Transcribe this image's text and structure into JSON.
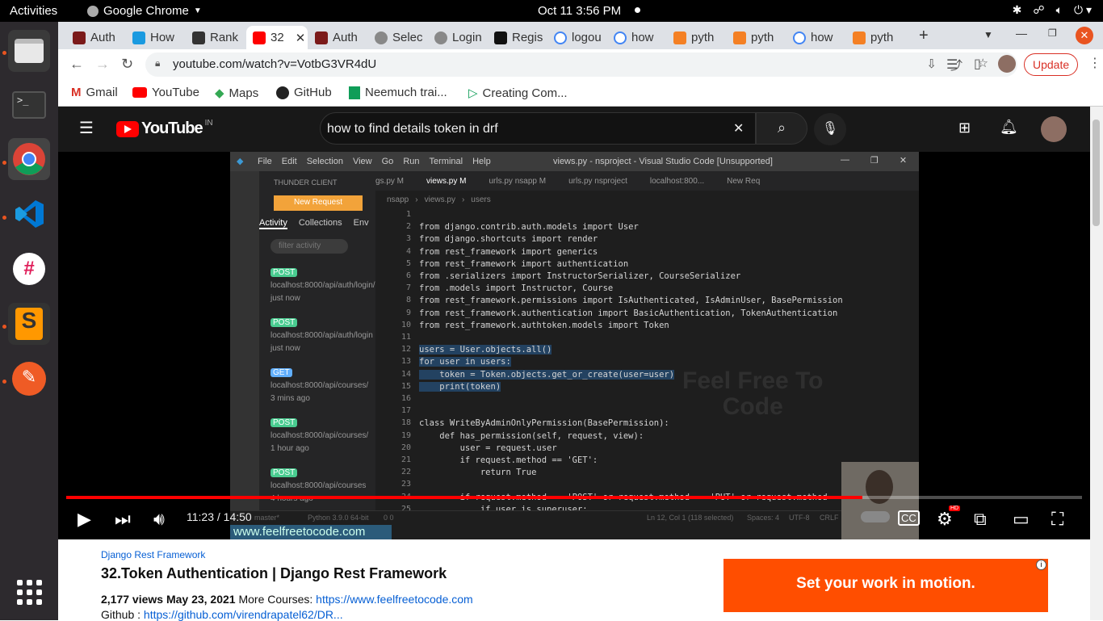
{
  "topbar": {
    "activities": "Activities",
    "app": "Google Chrome",
    "clock": "Oct 11  3:56 PM"
  },
  "dock": [
    "Files",
    "Terminal",
    "Google Chrome",
    "Visual Studio Code",
    "Slack",
    "Sublime Text",
    "Postman",
    "Show Applications"
  ],
  "tabs": [
    "Auth",
    "How",
    "Rank",
    "32",
    "Auth",
    "Selec",
    "Login",
    "Regis",
    "logou",
    "how",
    "pyth",
    "pyth",
    "how",
    "pyth"
  ],
  "omnibox": {
    "url": "youtube.com/watch?v=VotbG3VR4dU",
    "update": "Update"
  },
  "bookmarks": [
    "Gmail",
    "YouTube",
    "Maps",
    "GitHub",
    "Neemuch trai...",
    "Creating Com..."
  ],
  "youtube": {
    "logo": "YouTube",
    "region": "IN",
    "search_value": "how to find details token  in drf"
  },
  "vscode": {
    "title": "views.py - nsproject - Visual Studio Code [Unsupported]",
    "menu": [
      "File",
      "Edit",
      "Selection",
      "View",
      "Go",
      "Run",
      "Terminal",
      "Help"
    ],
    "panel_title": "THUNDER CLIENT",
    "new_request": "New Request",
    "panel_tabs": [
      "Activity",
      "Collections",
      "Env"
    ],
    "filter_placeholder": "filter activity",
    "activity": [
      {
        "method": "POST",
        "url": "localhost:8000/api/auth/login/",
        "time": "just now"
      },
      {
        "method": "POST",
        "url": "localhost:8000/api/auth/login",
        "time": "just now"
      },
      {
        "method": "GET",
        "url": "localhost:8000/api/courses/",
        "time": "3 mins ago"
      },
      {
        "method": "POST",
        "url": "localhost:8000/api/courses/",
        "time": "1 hour ago"
      },
      {
        "method": "POST",
        "url": "localhost:8000/api/courses",
        "time": "4 hours ago"
      }
    ],
    "editor_tabs": [
      "gs.py M",
      "views.py M",
      "urls.py nsapp M",
      "urls.py nsproject",
      "localhost:800...",
      "New Req"
    ],
    "breadcrumb": [
      "nsapp",
      "views.py",
      "users"
    ],
    "code_lines": [
      "",
      "from django.contrib.auth.models import User",
      "from django.shortcuts import render",
      "from rest_framework import generics",
      "from rest_framework import authentication",
      "from .serializers import InstructorSerializer, CourseSerializer",
      "from .models import Instructor, Course",
      "from rest_framework.permissions import IsAuthenticated, IsAdminUser, BasePermission",
      "from rest_framework.authentication import BasicAuthentication, TokenAuthentication",
      "from rest_framework.authtoken.models import Token",
      "",
      "users = User.objects.all()",
      "for user in users:",
      "    token = Token.objects.get_or_create(user=user)",
      "    print(token)",
      "",
      "",
      "class WriteByAdminOnlyPermission(BasePermission):",
      "    def has_permission(self, request, view):",
      "        user = request.user",
      "        if request.method == 'GET':",
      "            return True",
      "",
      "        if request.method == 'POST' or request.method == 'PUT' or request.method == 'DELETE':",
      "            if user.is_superuser:"
    ],
    "status": {
      "branch": "master*",
      "python": "Python 3.9.0 64-bit",
      "errors": "0  0",
      "cursor": "Ln 12, Col 1 (118 selected)",
      "spaces": "Spaces: 4",
      "encoding": "UTF-8",
      "eol": "CRLF"
    },
    "watermark": [
      "Feel Free To",
      "Code"
    ],
    "site_watermark": "www.feelfreetocode.com"
  },
  "player": {
    "time": "11:23 / 14:50",
    "progress": 0.784,
    "hd_badge": "HD"
  },
  "video": {
    "channel": "Django Rest Framework",
    "title": "32.Token Authentication | Django Rest Framework",
    "meta": "2,177 views  May 23, 2021",
    "more_label": "More Courses:",
    "more_link": "https://www.feelfreetocode.com",
    "github_label": "Github :",
    "github_link": "https://github.com/virendrapatel62/DR..."
  },
  "ad": {
    "text": "Set your work in motion."
  }
}
